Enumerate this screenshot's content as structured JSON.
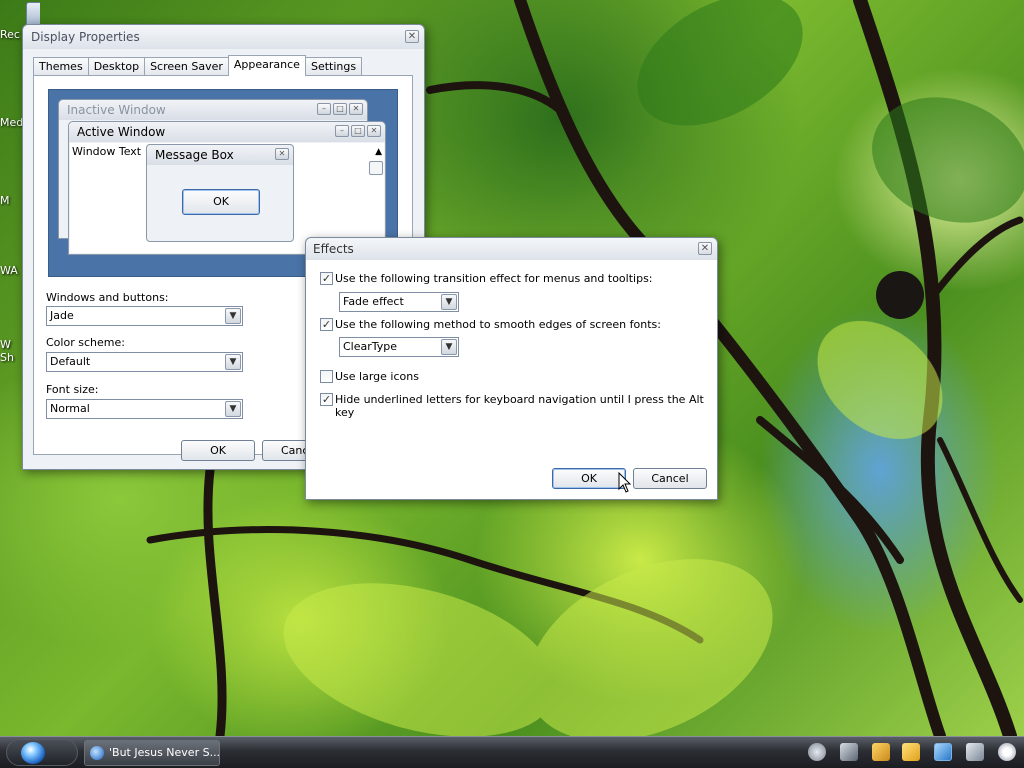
{
  "desktop": {
    "icons": [
      {
        "label": "Rec"
      },
      {
        "label": "Med"
      },
      {
        "label": "M"
      },
      {
        "label": "WA"
      },
      {
        "label": "W"
      },
      {
        "label": "Sh"
      }
    ]
  },
  "display_properties": {
    "title": "Display Properties",
    "close_glyph": "✕",
    "tabs": [
      "Themes",
      "Desktop",
      "Screen Saver",
      "Appearance",
      "Settings"
    ],
    "active_tab": "Appearance",
    "preview": {
      "inactive_title": "Inactive Window",
      "active_title": "Active Window",
      "window_text": "Window Text",
      "message_box_title": "Message Box",
      "ok_label": "OK"
    },
    "windows_buttons": {
      "label": "Windows and buttons:",
      "value": "Jade"
    },
    "color_scheme": {
      "label": "Color scheme:",
      "value": "Default"
    },
    "font_size": {
      "label": "Font size:",
      "value": "Normal"
    },
    "ok_label": "OK",
    "cancel_label": "Canc"
  },
  "effects": {
    "title": "Effects",
    "close_glyph": "✕",
    "transition": {
      "label": "Use the following transition effect for menus and tooltips:",
      "checked": true,
      "value": "Fade effect"
    },
    "smooth": {
      "label": "Use the following method to smooth edges of screen fonts:",
      "checked": true,
      "value": "ClearType"
    },
    "large_icons": {
      "label": "Use large icons",
      "checked": false
    },
    "hide_underline": {
      "label": "Hide underlined letters for keyboard navigation until I press the Alt key",
      "checked": true
    },
    "ok_label": "OK",
    "cancel_label": "Cancel"
  },
  "taskbar": {
    "task_label": "'But Jesus Never S..."
  },
  "colors": {
    "preview_bg": "#4a73a8",
    "taskbar": "#2b2e33",
    "accent": "#3d6aa6"
  }
}
